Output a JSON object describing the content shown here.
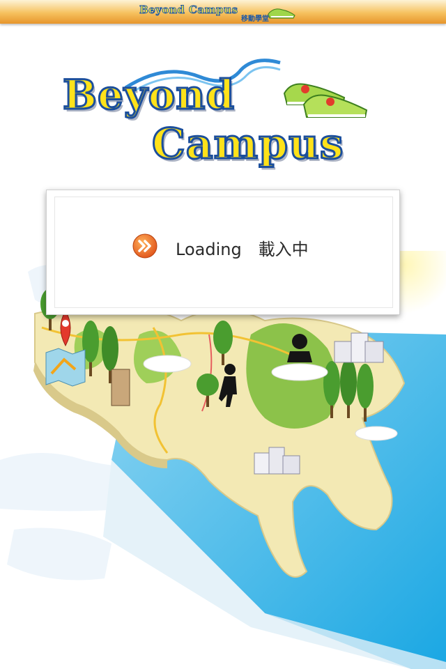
{
  "header": {
    "title": "Beyond Campus",
    "subtitle": "移動學堂"
  },
  "logo": {
    "line1": "Beyond",
    "line2": "Campus"
  },
  "loading": {
    "text": "Loading　載入中"
  },
  "colors": {
    "header_top": "#fdf3d6",
    "header_bottom": "#e7952c",
    "logo_fill": "#ffe21a",
    "logo_stroke": "#1c4f9c",
    "sea": "#3fb6e6",
    "land": "#f3e9b4",
    "hills": "#8cc24a",
    "tree": "#4a9d2f",
    "loading_icon": "#f26a1b"
  },
  "icons": [
    "forward-arrow-icon",
    "map-pin-icon",
    "shoe-icon",
    "hiker-icon",
    "building-icon",
    "tree-icon",
    "map-icon"
  ]
}
